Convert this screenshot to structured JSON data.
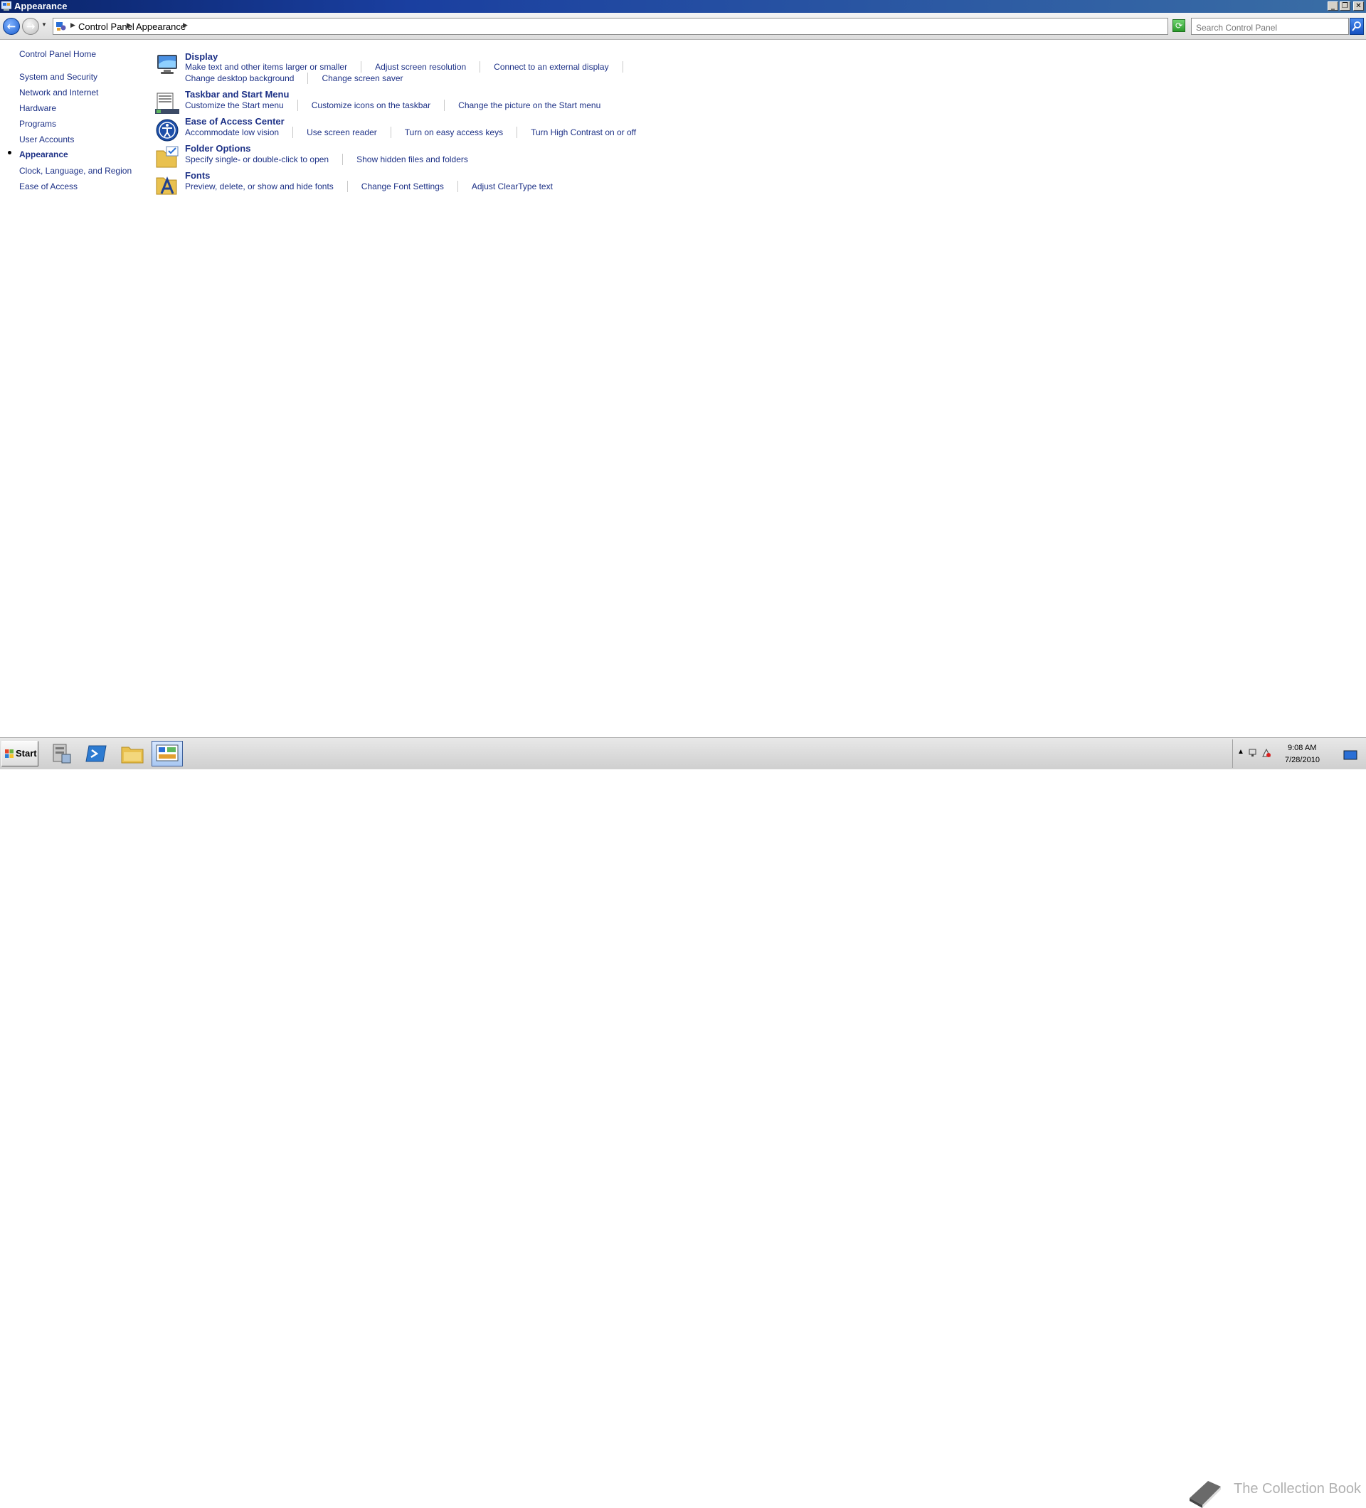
{
  "window": {
    "title": "Appearance"
  },
  "address_bar": {
    "breadcrumbs": [
      "Control Panel",
      "Appearance"
    ],
    "search_placeholder": "Search Control Panel"
  },
  "left_nav": {
    "items": [
      {
        "label": "Control Panel Home"
      },
      {
        "label": "System and Security"
      },
      {
        "label": "Network and Internet"
      },
      {
        "label": "Hardware"
      },
      {
        "label": "Programs"
      },
      {
        "label": "User Accounts"
      },
      {
        "label": "Appearance",
        "current": true
      },
      {
        "label": "Clock, Language, and Region"
      },
      {
        "label": "Ease of Access"
      }
    ]
  },
  "categories": [
    {
      "title": "Display",
      "icon": "display-icon",
      "tasks": [
        [
          "Make text and other items larger or smaller",
          "Adjust screen resolution",
          "Connect to an external display"
        ],
        [
          "Change desktop background",
          "Change screen saver"
        ]
      ]
    },
    {
      "title": "Taskbar and Start Menu",
      "icon": "taskbar-icon",
      "tasks": [
        [
          "Customize the Start menu",
          "Customize icons on the taskbar",
          "Change the picture on the Start menu"
        ]
      ]
    },
    {
      "title": "Ease of Access Center",
      "icon": "ease-of-access-icon",
      "tasks": [
        [
          "Accommodate low vision",
          "Use screen reader",
          "Turn on easy access keys",
          "Turn High Contrast on or off"
        ]
      ]
    },
    {
      "title": "Folder Options",
      "icon": "folder-options-icon",
      "tasks": [
        [
          "Specify single- or double-click to open",
          "Show hidden files and folders"
        ]
      ]
    },
    {
      "title": "Fonts",
      "icon": "fonts-icon",
      "tasks": [
        [
          "Preview, delete, or show and hide fonts",
          "Change Font Settings",
          "Adjust ClearType text"
        ]
      ]
    }
  ],
  "taskbar": {
    "start_label": "Start",
    "buttons": [
      "server-manager-icon",
      "powershell-icon",
      "explorer-icon",
      "control-panel-icon"
    ],
    "clock_time": "9:08 AM",
    "clock_date": "7/28/2010",
    "watermark": "The Collection Book"
  },
  "colors": {
    "link": "#1e3287",
    "titlebar": "#0a246a",
    "background": "#ffffff"
  }
}
